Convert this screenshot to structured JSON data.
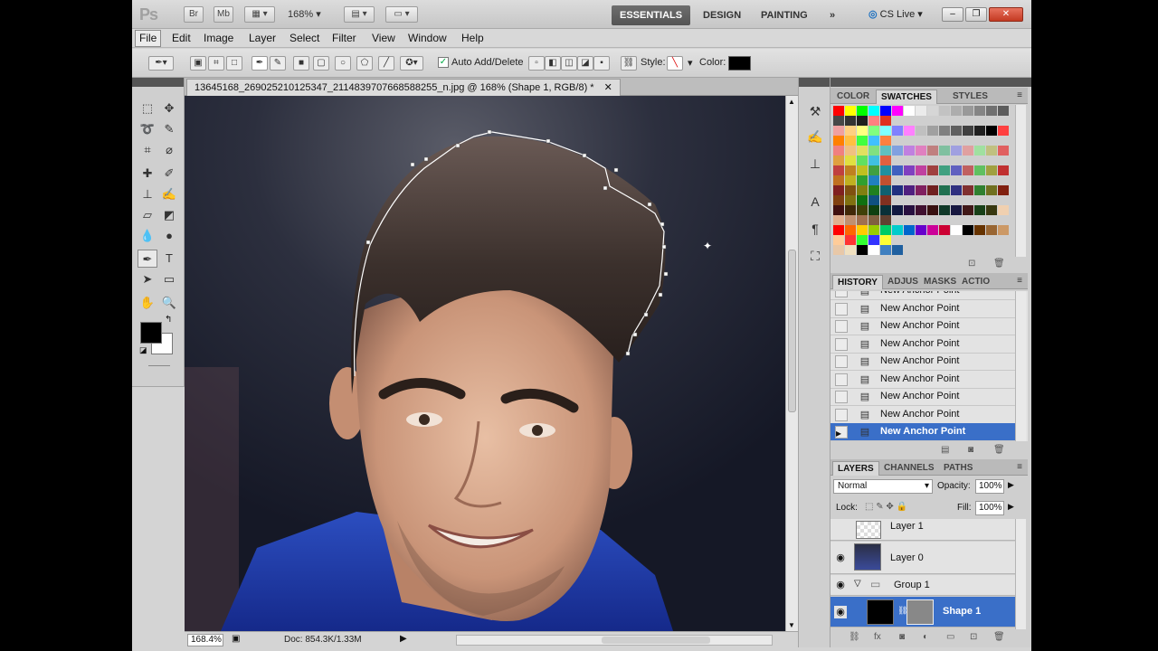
{
  "app": {
    "logo": "Ps",
    "bridge_label": "Br",
    "minibridge_label": "Mb",
    "zoom_level": "168%",
    "workspaces": [
      "ESSENTIALS",
      "DESIGN",
      "PAINTING",
      "»"
    ],
    "cs_live": "CS Live",
    "window_buttons": [
      "–",
      "❐",
      "✕"
    ]
  },
  "menu": [
    "File",
    "Edit",
    "Image",
    "Layer",
    "Select",
    "Filter",
    "View",
    "Window",
    "Help"
  ],
  "options": {
    "auto_add_delete": "Auto Add/Delete",
    "auto_add_checked": true,
    "style_label": "Style:",
    "color_label": "Color:",
    "color_value": "#000000"
  },
  "document": {
    "tab_title": "13645168_269025210125347_2114839707668588255_n.jpg @ 168% (Shape 1, RGB/8) *",
    "tab_close": "✕",
    "status_zoom": "168.4%",
    "doc_info": "Doc: 854.3K/1.33M"
  },
  "colors_panel": {
    "tabs": [
      "COLOR",
      "SWATCHES",
      "STYLES"
    ],
    "active_tab": "SWATCHES",
    "swatch_rows": [
      [
        "#ff0000",
        "#ffff00",
        "#00ff00",
        "#00ffff",
        "#0000ff",
        "#ff00ff",
        "#ffffff",
        "#ebebeb",
        "#d6d6d6",
        "#c2c2c2",
        "#adadad",
        "#999999",
        "#858585",
        "#707070",
        "#5c5c5c",
        "#474747",
        "#333333",
        "#1f1f1f",
        "#ff8080",
        "#e0301e"
      ],
      [
        "#f0a0a0",
        "#ffd080",
        "#ffff80",
        "#80ff80",
        "#80ffff",
        "#8080ff",
        "#ff80ff",
        "#c0c0c0",
        "#a0a0a0",
        "#808080",
        "#606060",
        "#404040",
        "#202020",
        "#000000",
        "#ff4040",
        "#ff8000",
        "#ffc040",
        "#40ff40",
        "#40c0ff",
        "#ff8040"
      ],
      [
        "#f08080",
        "#f0c080",
        "#e0e060",
        "#80e080",
        "#60c0c0",
        "#80a0e0",
        "#c080e0",
        "#e080c0",
        "#c08080",
        "#80c0a0",
        "#a0a0e0",
        "#e0a0a0",
        "#a0e0a0",
        "#c0c080",
        "#e06060",
        "#e0a040",
        "#e0e040",
        "#60e060",
        "#40c0e0",
        "#e06040"
      ],
      [
        "#c04040",
        "#c08020",
        "#c0c020",
        "#40a040",
        "#2090a0",
        "#4060c0",
        "#8040c0",
        "#c040a0",
        "#a04040",
        "#40a080",
        "#6060c0",
        "#c06060",
        "#60c060",
        "#a0a040",
        "#c03030",
        "#c07020",
        "#c0b020",
        "#30a030",
        "#2080c0",
        "#c05030"
      ],
      [
        "#802020",
        "#805010",
        "#808010",
        "#208020",
        "#106070",
        "#203080",
        "#502080",
        "#802060",
        "#702020",
        "#207050",
        "#303080",
        "#803030",
        "#308030",
        "#707020",
        "#802010",
        "#804010",
        "#807010",
        "#107010",
        "#105080",
        "#803020"
      ],
      [
        "#401010",
        "#402808",
        "#404008",
        "#104010",
        "#083038",
        "#101840",
        "#281040",
        "#401030",
        "#381010",
        "#103828",
        "#181840",
        "#401818",
        "#184018",
        "#383810",
        "#f0d0b0",
        "#e0b090",
        "#c09070",
        "#a07050",
        "#806040",
        "#604030"
      ],
      [
        "#ff0000",
        "#ff6600",
        "#ffcc00",
        "#99cc00",
        "#00cc66",
        "#00cccc",
        "#0066cc",
        "#6600cc",
        "#cc0099",
        "#cc0033",
        "#ffffff",
        "#000000",
        "#663300",
        "#996633",
        "#cc9966",
        "#ffcc99",
        "#ff3333",
        "#33ff33",
        "#3333ff",
        "#ffff33"
      ],
      [
        "#e8c8a8",
        "#f0e0c0",
        "#000000",
        "#ffffff",
        "#4080c0",
        "#2060a0"
      ]
    ]
  },
  "history_panel": {
    "tabs": [
      "HISTORY",
      "ADJUS",
      "MASKS",
      "ACTIO"
    ],
    "active_tab": "HISTORY",
    "items": [
      "New Anchor Point",
      "New Anchor Point",
      "New Anchor Point",
      "New Anchor Point",
      "New Anchor Point",
      "New Anchor Point",
      "New Anchor Point",
      "New Anchor Point",
      "New Anchor Point"
    ],
    "selected_index": 8
  },
  "layers_panel": {
    "tabs": [
      "LAYERS",
      "CHANNELS",
      "PATHS"
    ],
    "active_tab": "LAYERS",
    "blend_mode": "Normal",
    "opacity_label": "Opacity:",
    "opacity": "100%",
    "lock_label": "Lock:",
    "fill_label": "Fill:",
    "fill": "100%",
    "layers": [
      {
        "name": "Layer 1",
        "visible": false
      },
      {
        "name": "Layer 0",
        "visible": true
      },
      {
        "name": "Group 1",
        "visible": true
      },
      {
        "name": "Shape 1",
        "visible": true
      }
    ],
    "selected": "Shape 1"
  }
}
